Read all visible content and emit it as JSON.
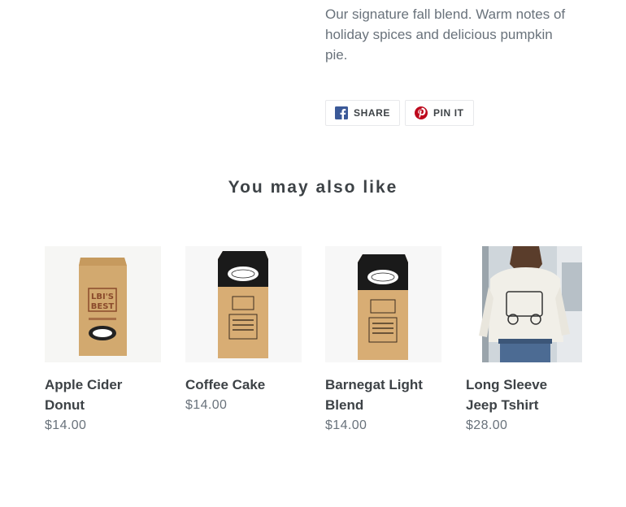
{
  "product": {
    "description": "Our signature fall blend. Warm notes of holiday spices and delicious pumpkin pie."
  },
  "share": {
    "facebook_label": "SHARE",
    "pinterest_label": "PIN IT"
  },
  "related": {
    "title": "You may also like",
    "items": [
      {
        "name": "Apple Cider Donut",
        "price": "$14.00",
        "image": "coffee-bag-kraft-lbis-best"
      },
      {
        "name": "Coffee Cake",
        "price": "$14.00",
        "image": "coffee-bag-black-top"
      },
      {
        "name": "Barnegat Light Blend",
        "price": "$14.00",
        "image": "coffee-bag-black-top"
      },
      {
        "name": "Long Sleeve Jeep Tshirt",
        "price": "$28.00",
        "image": "person-wearing-shirt"
      }
    ]
  },
  "colors": {
    "text": "#3d4246",
    "muted": "#69727b",
    "facebook": "#3b5998",
    "pinterest": "#bd081c",
    "kraft": "#d2a96f"
  }
}
